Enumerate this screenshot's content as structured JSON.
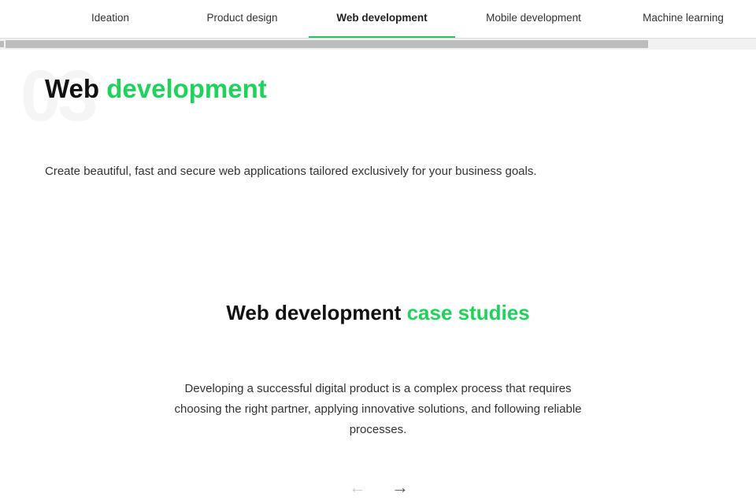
{
  "tabs": [
    {
      "label": "Ideation"
    },
    {
      "label": "Product design"
    },
    {
      "label": "Web development",
      "active": true
    },
    {
      "label": "Mobile development"
    },
    {
      "label": "Machine learning"
    }
  ],
  "section": {
    "number": "03",
    "title_a": "Web",
    "title_b": "development",
    "description": "Create beautiful, fast and secure web applications tailored exclusively for your business goals."
  },
  "case_studies": {
    "title_a": "Web development",
    "title_b": "case studies",
    "text": "Developing a successful digital product is a complex process that requires choosing the right partner, applying innovative solutions, and following reliable processes.",
    "prev": "←",
    "next": "→"
  },
  "colors": {
    "accent": "#1ed35a"
  }
}
